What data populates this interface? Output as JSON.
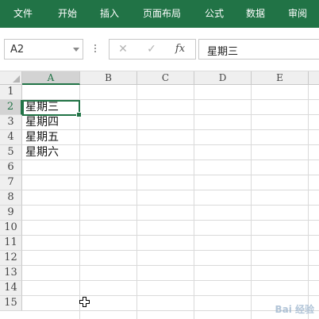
{
  "ribbon": {
    "tabs": [
      {
        "label": "文件"
      },
      {
        "label": "开始"
      },
      {
        "label": "插入"
      },
      {
        "label": "页面布局"
      },
      {
        "label": "公式"
      },
      {
        "label": "数据"
      },
      {
        "label": "审阅"
      }
    ]
  },
  "formula_bar": {
    "name_box": "A2",
    "cancel_icon": "close-icon",
    "confirm_icon": "check-icon",
    "function_label": "fx",
    "formula_value": "星期三"
  },
  "grid": {
    "columns": [
      "A",
      "B",
      "C",
      "D",
      "E"
    ],
    "selected_column": "A",
    "rows": [
      "1",
      "2",
      "3",
      "4",
      "5",
      "6",
      "7",
      "8",
      "9",
      "10",
      "11",
      "12",
      "13",
      "14",
      "15"
    ],
    "selected_row": "2",
    "cells": {
      "A2": "星期三",
      "A3": "星期四",
      "A4": "星期五",
      "A5": "星期六"
    },
    "active_cell": "A2"
  },
  "watermark": "Bai 经验",
  "colors": {
    "ribbon": "#217346",
    "accent": "#217346",
    "header_bg": "#efefef",
    "gridline": "#dadada"
  }
}
